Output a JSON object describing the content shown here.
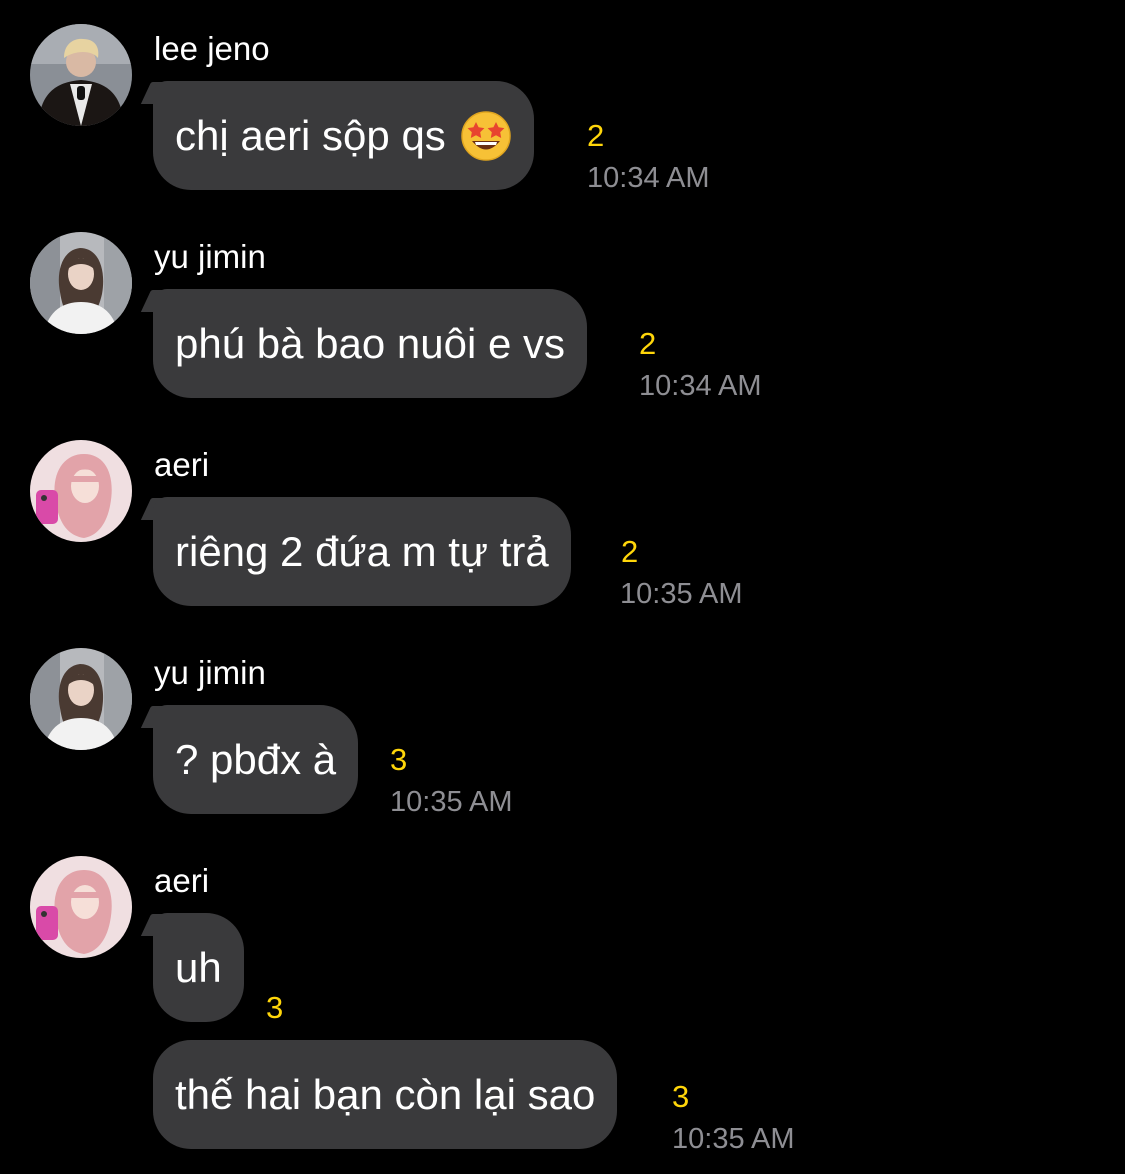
{
  "messages": [
    {
      "sender": "lee jeno",
      "text": "chị aeri sộp qs",
      "emoji": "star-struck-emoji",
      "read_count": "2",
      "time": "10:34 AM"
    },
    {
      "sender": "yu jimin",
      "text": "phú bà bao nuôi e vs",
      "read_count": "2",
      "time": "10:34 AM"
    },
    {
      "sender": "aeri",
      "text": "riêng 2 đứa m tự trả",
      "read_count": "2",
      "time": "10:35 AM"
    },
    {
      "sender": "yu jimin",
      "text": "? pbđx à",
      "read_count": "3",
      "time": "10:35 AM"
    },
    {
      "sender": "aeri",
      "text": "uh",
      "read_count": "3"
    },
    {
      "text": "thế hai bạn còn lại sao",
      "read_count": "3",
      "time": "10:35 AM"
    }
  ],
  "colors": {
    "background": "#000000",
    "bubble": "#3a3a3c",
    "read_count": "#ffd60a",
    "timestamp": "#8e8e93"
  },
  "icons": {
    "avatar_lee_jeno": "avatar-lee-jeno",
    "avatar_yu_jimin": "avatar-yu-jimin",
    "avatar_aeri": "avatar-aeri"
  }
}
